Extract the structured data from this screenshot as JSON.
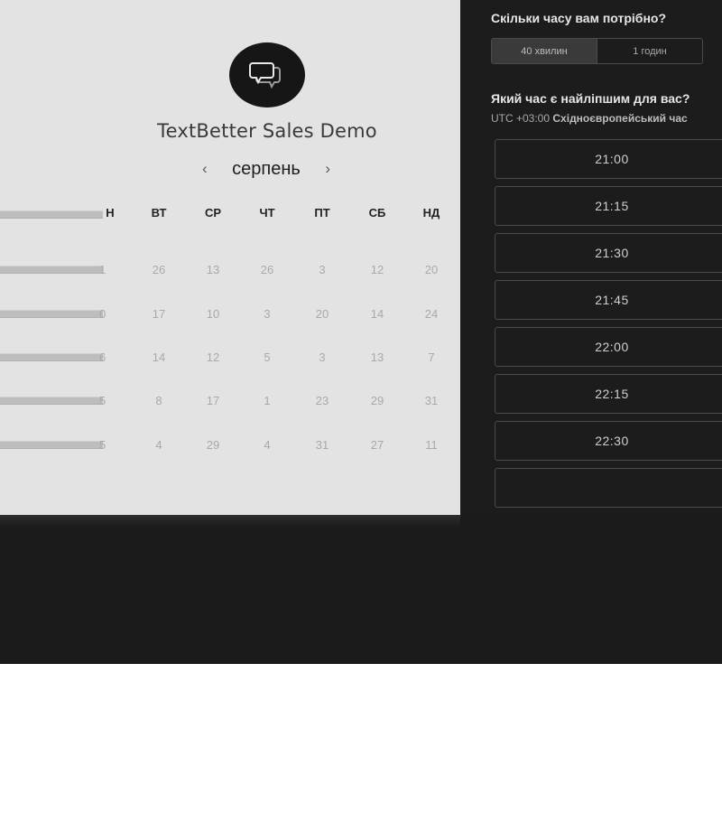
{
  "event": {
    "title": "TextBetter Sales Demo",
    "logo_icon": "chat-bubbles-icon"
  },
  "calendar": {
    "month": "серпень",
    "prev_icon": "‹",
    "next_icon": "›",
    "day_headers": [
      "Н",
      "ВТ",
      "СР",
      "ЧТ",
      "ПТ",
      "СБ",
      "НД"
    ],
    "weeks": [
      [
        "1",
        "26",
        "13",
        "26",
        "3",
        "12",
        "20"
      ],
      [
        "0",
        "17",
        "10",
        "3",
        "20",
        "14",
        "24"
      ],
      [
        "6",
        "14",
        "12",
        "5",
        "3",
        "13",
        "7"
      ],
      [
        "5",
        "8",
        "17",
        "1",
        "23",
        "29",
        "31"
      ],
      [
        "5",
        "4",
        "29",
        "4",
        "31",
        "27",
        "11"
      ]
    ]
  },
  "scheduler": {
    "duration_question": "Скільки часу вам потрібно?",
    "durations": [
      "40 хвилин",
      "1 годин"
    ],
    "selected_duration": "40 хвилин",
    "time_question": "Який час є найліпшим для вас?",
    "timezone_offset": "UTC +03:00",
    "timezone_name": "Східноєвропейський час",
    "time_slots": [
      "21:00",
      "21:15",
      "21:30",
      "21:45",
      "22:00",
      "22:15",
      "22:30",
      ""
    ]
  },
  "colors": {
    "left_panel": "#e3e3e3",
    "right_panel": "#1c1c1c",
    "bottom_band": "#1b1b1b"
  }
}
